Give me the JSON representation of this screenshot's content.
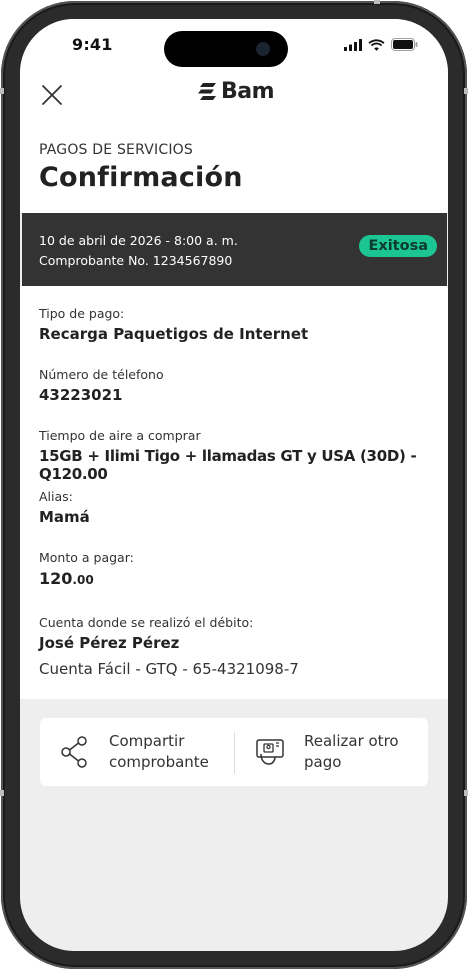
{
  "status_bar": {
    "time": "9:41",
    "icons": [
      "signal-icon",
      "wifi-icon",
      "battery-icon"
    ]
  },
  "header": {
    "close_icon": "close-icon",
    "logo_text": "Bam",
    "section_label": "PAGOS DE SERVICIOS",
    "title": "Confirmación"
  },
  "receipt": {
    "date": "10 de abril de 2026 - 8:00 a. m.",
    "number": "Comprobante No. 1234567890",
    "status": "Exitosa",
    "status_color": "#1bc694"
  },
  "details": {
    "payment_type": {
      "label": "Tipo de pago:",
      "value": "Recarga Paquetigos de Internet"
    },
    "phone": {
      "label": "Número de télefono",
      "value": "43223021"
    },
    "airtime": {
      "label": "Tiempo de aire a comprar",
      "value": "15GB + Ilimi Tigo + llamadas GT y USA (30D) - Q120.00"
    },
    "alias": {
      "label": "Alias:",
      "value": "Mamá"
    },
    "amount": {
      "label": "Monto a pagar:",
      "value_main": "120",
      "value_cents": ".00"
    },
    "account": {
      "label": "Cuenta donde se realizó el débito:",
      "holder": "José Pérez Pérez",
      "account": "Cuenta Fácil - GTQ - 65-4321098-7"
    }
  },
  "actions": {
    "share": {
      "icon": "share-icon",
      "line1": "Compartir",
      "line2": "comprobante"
    },
    "new_payment": {
      "icon": "payment-icon",
      "line1": "Realizar otro",
      "line2": "pago"
    }
  },
  "colors": {
    "receipt_bar": "#333333",
    "background": "#eeeeee",
    "accent": "#1bc694"
  }
}
